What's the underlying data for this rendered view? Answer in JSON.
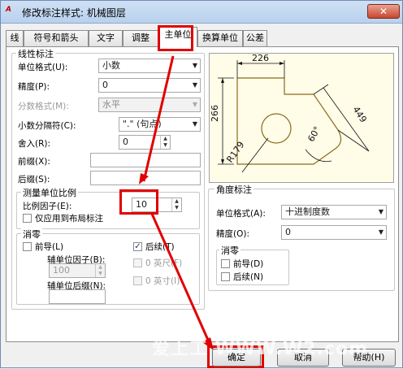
{
  "window": {
    "title": "修改标注样式: 机械图层",
    "close_glyph": "✕",
    "app_icon_text": "A"
  },
  "tabs": [
    {
      "label": "线"
    },
    {
      "label": "符号和箭头"
    },
    {
      "label": "文字"
    },
    {
      "label": "调整"
    },
    {
      "label": "主单位",
      "active": true
    },
    {
      "label": "换算单位"
    },
    {
      "label": "公差"
    }
  ],
  "linear": {
    "title": "线性标注",
    "unit_format_label": "单位格式(U):",
    "unit_format_value": "小数",
    "precision_label": "精度(P):",
    "precision_value": "0",
    "fraction_format_label": "分数格式(M):",
    "fraction_format_value": "水平",
    "decimal_sep_label": "小数分隔符(C):",
    "decimal_sep_value": "\".\" (句点)",
    "round_off_label": "舍入(R):",
    "round_off_value": "0",
    "prefix_label": "前缀(X):",
    "prefix_value": "",
    "suffix_label": "后缀(S):",
    "suffix_value": ""
  },
  "scale": {
    "title": "测量单位比例",
    "factor_label": "比例因子(E):",
    "factor_value": "10",
    "layout_only_label": "仅应用到布局标注"
  },
  "zero": {
    "title": "消零",
    "leading_label": "前导(L)",
    "trailing_label": "后续(T)",
    "trailing_checked": "✓",
    "sub_factor_label": "辅单位因子(B):",
    "sub_factor_value": "100",
    "zero_feet_label": "0 英尺(F)",
    "sub_suffix_label": "辅单位后缀(N):",
    "zero_inches_label": "0 英寸(I)"
  },
  "angular": {
    "title": "角度标注",
    "unit_format_label": "单位格式(A):",
    "unit_format_value": "十进制度数",
    "precision_label": "精度(O):",
    "precision_value": "0",
    "zero_title": "消零",
    "leading_label": "前导(D)",
    "trailing_label": "后续(N)"
  },
  "preview": {
    "dim_top": "226",
    "dim_left": "266",
    "dim_right": "449",
    "dim_radius": "R179",
    "dim_angle": "60°"
  },
  "buttons": {
    "ok": "确定",
    "cancel": "取消",
    "help": "帮助(H)"
  },
  "watermark": "爱上工 WWW.W2.com",
  "colors": {
    "annotation_red": "#e00000",
    "preview_bg": "#fffce8",
    "drawing": "#8a6d1a"
  }
}
